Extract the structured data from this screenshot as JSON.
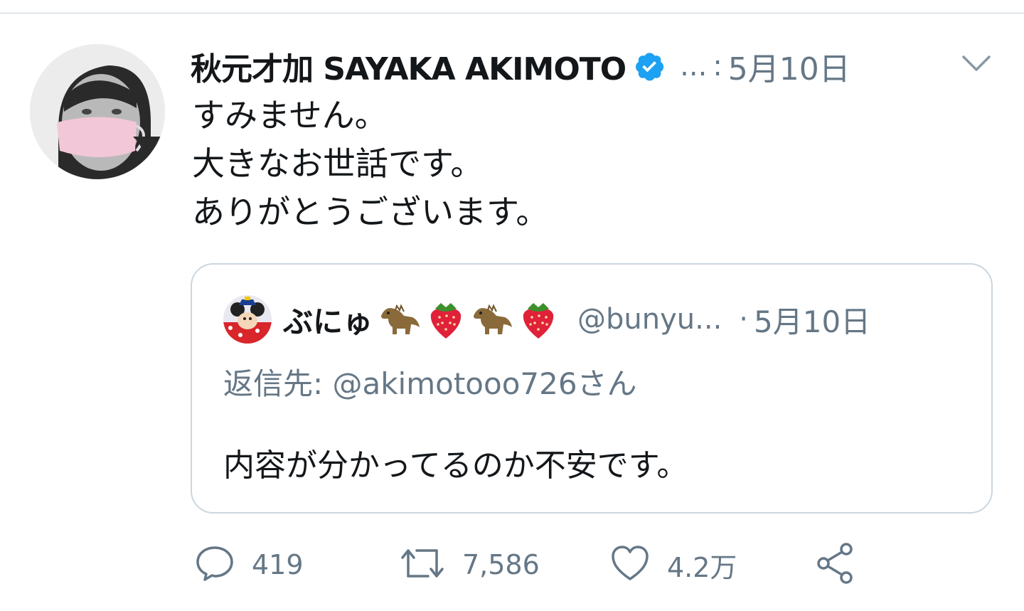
{
  "tweet": {
    "display_name": "秋元才加 SAYAKA AKIMOTO",
    "handle_truncated": "...",
    "separator": ":",
    "date": "5月10日",
    "verified": true,
    "lines": [
      "すみません。",
      "大きなお世話です。",
      "ありがとうございます。"
    ]
  },
  "quote": {
    "display_name": "ぶにゅ",
    "emojis": [
      "dinosaur-icon",
      "strawberry-icon",
      "dinosaur-icon",
      "strawberry-icon"
    ],
    "handle": "@bunyu...",
    "separator": "·",
    "date": "5月10日",
    "reply_to": "返信先: @akimotooo726さん",
    "text": "内容が分かってるのか不安です。"
  },
  "actions": {
    "replies": "419",
    "retweets": "7,586",
    "likes": "4.2万"
  },
  "colors": {
    "text": "#14171a",
    "secondary": "#657786",
    "border": "#ccd6dd",
    "verified": "#1da1f2"
  }
}
